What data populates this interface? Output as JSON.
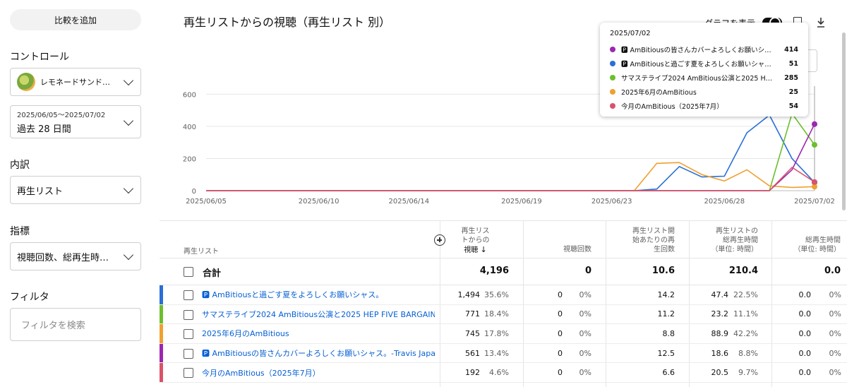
{
  "sidebar": {
    "compare_label": "比較を追加",
    "controls_label": "コントロール",
    "channel_name": "レモネードサンド…",
    "date_range_small": "2025/06/05〜2025/07/02",
    "date_range_label": "過去 28 日間",
    "breakdown_label": "内訳",
    "breakdown_value": "再生リスト",
    "metrics_label": "指標",
    "metrics_value": "視聴回数、総再生時…",
    "filter_label": "フィルタ",
    "filter_placeholder": "フィルタを検索"
  },
  "header": {
    "title": "再生リストからの視聴（再生リスト 別）",
    "graph_toggle_label": "グラフを表示"
  },
  "tooltip": {
    "date": "2025/07/02",
    "rows": [
      {
        "name": "🅿 AmBitiousの皆さんカバーよろしくお願いシャ…",
        "value": "414",
        "color": "#9c27b0"
      },
      {
        "name": "🅿 AmBitiousと過ごす夏をよろしくお願いシャス…",
        "value": "51",
        "color": "#2a6fd6"
      },
      {
        "name": "サマステライブ2024 AmBitious公演と2025 HE…",
        "value": "285",
        "color": "#6cbf2c"
      },
      {
        "name": "2025年6月のAmBitious",
        "value": "25",
        "color": "#f0a030"
      },
      {
        "name": "今月のAmBitious（2025年7月）",
        "value": "54",
        "color": "#d9536a"
      }
    ]
  },
  "chart_data": {
    "type": "line",
    "x": [
      "2025/06/05",
      "2025/06/06",
      "2025/06/07",
      "2025/06/08",
      "2025/06/09",
      "2025/06/10",
      "2025/06/11",
      "2025/06/12",
      "2025/06/13",
      "2025/06/14",
      "2025/06/15",
      "2025/06/16",
      "2025/06/17",
      "2025/06/18",
      "2025/06/19",
      "2025/06/20",
      "2025/06/21",
      "2025/06/22",
      "2025/06/23",
      "2025/06/24",
      "2025/06/25",
      "2025/06/26",
      "2025/06/27",
      "2025/06/28",
      "2025/06/29",
      "2025/06/30",
      "2025/07/01",
      "2025/07/02"
    ],
    "x_tick_labels": [
      "2025/06/05",
      "2025/06/10",
      "2025/06/14",
      "2025/06/19",
      "2025/06/23",
      "2025/06/28",
      "2025/07/02"
    ],
    "y_ticks": [
      "0",
      "200",
      "400",
      "600"
    ],
    "ylim": [
      0,
      650
    ],
    "grid": true,
    "series": [
      {
        "name": "AmBitiousと過ごす夏をよろしくお願いシャス。",
        "color": "#2a6fd6",
        "values": [
          0,
          0,
          0,
          0,
          0,
          0,
          0,
          0,
          0,
          0,
          0,
          0,
          0,
          0,
          0,
          0,
          0,
          0,
          0,
          0,
          10,
          150,
          85,
          90,
          360,
          470,
          200,
          51
        ]
      },
      {
        "name": "サマステライブ2024 AmBitious公演と2025 HEP FIVE BARGAIN",
        "color": "#6cbf2c",
        "values": [
          0,
          0,
          0,
          0,
          0,
          0,
          0,
          0,
          0,
          0,
          0,
          0,
          0,
          0,
          0,
          0,
          0,
          0,
          0,
          0,
          0,
          0,
          0,
          0,
          0,
          0,
          480,
          285
        ]
      },
      {
        "name": "2025年6月のAmBitious",
        "color": "#f0a030",
        "values": [
          0,
          0,
          0,
          0,
          0,
          0,
          0,
          0,
          0,
          0,
          0,
          0,
          0,
          0,
          0,
          0,
          0,
          0,
          0,
          0,
          170,
          175,
          100,
          60,
          130,
          30,
          20,
          25
        ]
      },
      {
        "name": "AmBitiousの皆さんカバーよろしくお願いシャス。-Travis Japan…",
        "color": "#9c27b0",
        "values": [
          0,
          0,
          0,
          0,
          0,
          0,
          0,
          0,
          0,
          0,
          0,
          0,
          0,
          0,
          0,
          0,
          0,
          0,
          0,
          0,
          0,
          0,
          0,
          0,
          0,
          0,
          130,
          414
        ]
      },
      {
        "name": "今月のAmBitious（2025年7月）",
        "color": "#d9536a",
        "values": [
          0,
          0,
          0,
          0,
          0,
          0,
          0,
          0,
          0,
          0,
          0,
          0,
          0,
          0,
          0,
          0,
          0,
          0,
          0,
          0,
          0,
          0,
          0,
          0,
          0,
          0,
          145,
          54
        ]
      }
    ]
  },
  "table": {
    "col_playlist": "再生リスト",
    "col_views_from": [
      "再生リス",
      "トからの",
      "視聴"
    ],
    "col_views": "視聴回数",
    "col_per_start": [
      "再生リスト開",
      "始あたりの再",
      "生回数"
    ],
    "col_watch_time": [
      "再生リストの",
      "総再生時間",
      "（単位: 時間）"
    ],
    "col_total_watch": [
      "総再生時間",
      "（単位: 時間）"
    ],
    "total": {
      "label": "合計",
      "views_from": "4,196",
      "views": "0",
      "per_start": "10.6",
      "watch_time": "210.4",
      "total_watch": "0.0"
    },
    "rows": [
      {
        "title": "🅿 AmBitiousと過ごす夏をよろしくお願いシャス。",
        "color": "#2a6fd6",
        "views_from": "1,494",
        "views_from_pct": "35.6%",
        "views": "0",
        "views_pct": "0%",
        "per_start": "14.2",
        "watch_time": "47.4",
        "watch_time_pct": "22.5%",
        "total_watch": "0.0",
        "total_watch_pct": "0%"
      },
      {
        "title": "サマステライブ2024 AmBitious公演と2025 HEP FIVE BARGAIN",
        "color": "#6cbf2c",
        "views_from": "771",
        "views_from_pct": "18.4%",
        "views": "0",
        "views_pct": "0%",
        "per_start": "11.2",
        "watch_time": "23.2",
        "watch_time_pct": "11.1%",
        "total_watch": "0.0",
        "total_watch_pct": "0%"
      },
      {
        "title": "2025年6月のAmBitious",
        "color": "#f0a030",
        "views_from": "745",
        "views_from_pct": "17.8%",
        "views": "0",
        "views_pct": "0%",
        "per_start": "8.8",
        "watch_time": "88.9",
        "watch_time_pct": "42.2%",
        "total_watch": "0.0",
        "total_watch_pct": "0%"
      },
      {
        "title": "🅿 AmBitiousの皆さんカバーよろしくお願いシャス。-Travis Japan…",
        "color": "#9c27b0",
        "views_from": "561",
        "views_from_pct": "13.4%",
        "views": "0",
        "views_pct": "0%",
        "per_start": "12.5",
        "watch_time": "18.6",
        "watch_time_pct": "8.8%",
        "total_watch": "0.0",
        "total_watch_pct": "0%"
      },
      {
        "title": "今月のAmBitious（2025年7月）",
        "color": "#d9536a",
        "views_from": "192",
        "views_from_pct": "4.6%",
        "views": "0",
        "views_pct": "0%",
        "per_start": "6.6",
        "watch_time": "20.5",
        "watch_time_pct": "9.7%",
        "total_watch": "0.0",
        "total_watch_pct": "0%"
      }
    ]
  }
}
